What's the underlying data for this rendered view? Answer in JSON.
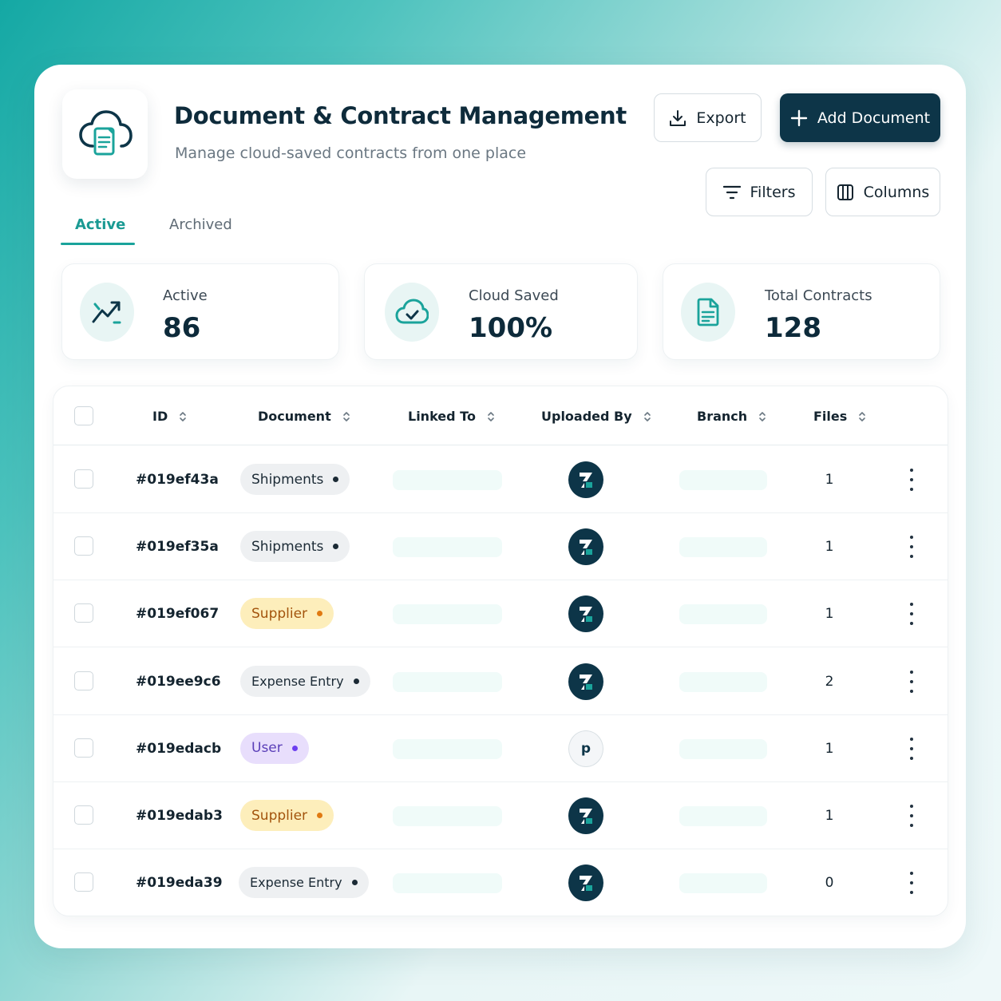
{
  "header": {
    "title": "Document & Contract Management",
    "subtitle": "Manage cloud-saved contracts from one place"
  },
  "toolbar": {
    "export_label": "Export",
    "add_label": "Add Document",
    "filters_label": "Filters",
    "columns_label": "Columns"
  },
  "tabs": [
    {
      "label": "Active",
      "active": true
    },
    {
      "label": "Archived",
      "active": false
    }
  ],
  "stats": [
    {
      "label": "Active",
      "value": "86",
      "icon": "trending-up-icon"
    },
    {
      "label": "Cloud Saved",
      "value": "100%",
      "icon": "cloud-check-icon"
    },
    {
      "label": "Total Contracts",
      "value": "128",
      "icon": "document-icon"
    }
  ],
  "table": {
    "columns": [
      "ID",
      "Document",
      "Linked To",
      "Uploaded By",
      "Branch",
      "Files"
    ],
    "rows": [
      {
        "id": "#019ef43a",
        "document": "Shipments",
        "doc_style": "grey",
        "uploader": "brand",
        "files": "1"
      },
      {
        "id": "#019ef35a",
        "document": "Shipments",
        "doc_style": "grey",
        "uploader": "brand",
        "files": "1"
      },
      {
        "id": "#019ef067",
        "document": "Supplier",
        "doc_style": "yellow",
        "uploader": "brand",
        "files": "1"
      },
      {
        "id": "#019ee9c6",
        "document": "Expense Entry",
        "doc_style": "grey",
        "uploader": "brand",
        "files": "2"
      },
      {
        "id": "#019edacb",
        "document": "User",
        "doc_style": "purple",
        "uploader": "letter",
        "uploader_letter": "p",
        "files": "1"
      },
      {
        "id": "#019edab3",
        "document": "Supplier",
        "doc_style": "yellow",
        "uploader": "brand",
        "files": "1"
      },
      {
        "id": "#019eda39",
        "document": "Expense Entry",
        "doc_style": "grey",
        "uploader": "brand",
        "files": "0"
      }
    ]
  },
  "colors": {
    "primary": "#0d3548",
    "accent": "#1aa39b",
    "chip_yellow": "#fdeebb",
    "chip_purple": "#e8defc",
    "chip_grey": "#eef0f2"
  }
}
